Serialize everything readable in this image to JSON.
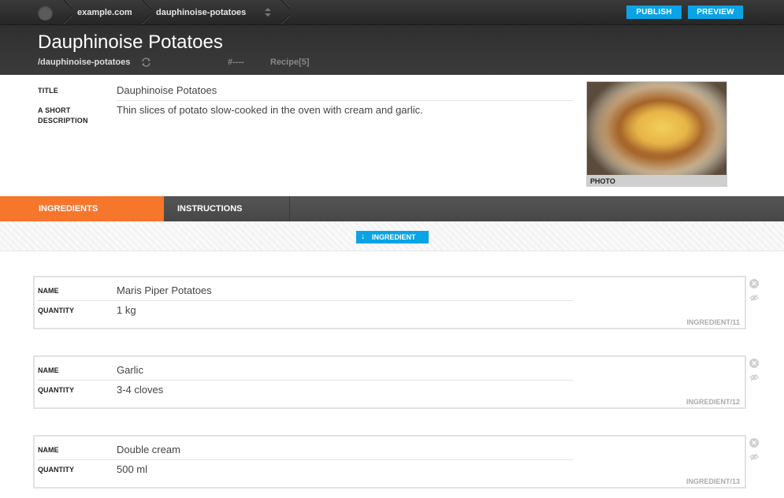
{
  "topbar": {
    "site": "example.com",
    "page": "dauphinoise-potatoes",
    "publish_label": "PUBLISH",
    "preview_label": "PREVIEW",
    "accent": "#0aa3e6"
  },
  "header": {
    "title": "Dauphinoise Potatoes",
    "slug": "/dauphinoise-potatoes",
    "hash": "#----",
    "type": "Recipe[5]"
  },
  "fields": {
    "title_label": "TITLE",
    "title_value": "Dauphinoise Potatoes",
    "description_label": "A SHORT DESCRIPTION",
    "description_value": "Thin slices of potato slow-cooked in the oven with cream and garlic.",
    "photo_label": "PHOTO"
  },
  "tabs": [
    {
      "label": "INGREDIENTS",
      "active": true,
      "color": "#f6762c"
    },
    {
      "label": "INSTRUCTIONS",
      "active": false
    }
  ],
  "add_button": {
    "label": "INGREDIENT",
    "icon": "arrow-down-icon"
  },
  "ingredients": [
    {
      "name_label": "NAME",
      "name": "Maris Piper Potatoes",
      "quantity_label": "QUANTITY",
      "quantity": "1 kg",
      "ref": "INGREDIENT/11"
    },
    {
      "name_label": "NAME",
      "name": "Garlic",
      "quantity_label": "QUANTITY",
      "quantity": "3-4 cloves",
      "ref": "INGREDIENT/12"
    },
    {
      "name_label": "NAME",
      "name": "Double cream",
      "quantity_label": "QUANTITY",
      "quantity": "500 ml",
      "ref": "INGREDIENT/13"
    }
  ]
}
